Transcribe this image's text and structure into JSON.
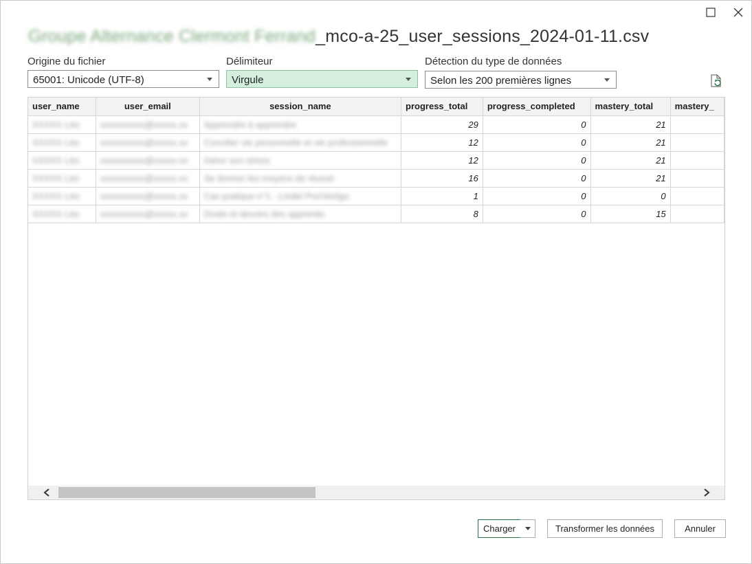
{
  "window": {
    "title_blurred": "Groupe Alternance Clermont Ferrand",
    "title_suffix": "_mco-a-25_user_sessions_2024-01-11.csv"
  },
  "options": {
    "origin": {
      "label": "Origine du fichier",
      "value": "65001: Unicode (UTF-8)"
    },
    "delimiter": {
      "label": "Délimiteur",
      "value": "Virgule"
    },
    "detection": {
      "label": "Détection du type de données",
      "value": "Selon les 200 premières lignes"
    }
  },
  "columns": [
    "user_name",
    "user_email",
    "session_name",
    "progress_total",
    "progress_completed",
    "mastery_total",
    "mastery_"
  ],
  "rows": [
    {
      "user_name": "XXXXX Léo",
      "user_email": "xxxxxxxxxx@xxxxx.xx",
      "session_name": "Apprendre à apprendre",
      "progress_total": "29",
      "progress_completed": "0",
      "mastery_total": "21"
    },
    {
      "user_name": "XXXXX Léo",
      "user_email": "xxxxxxxxxx@xxxxx.xx",
      "session_name": "Concilier vie personnelle et vie professionnelle",
      "progress_total": "12",
      "progress_completed": "0",
      "mastery_total": "21"
    },
    {
      "user_name": "XXXXX Léo",
      "user_email": "xxxxxxxxxx@xxxxx.xx",
      "session_name": "Gérer son stress",
      "progress_total": "12",
      "progress_completed": "0",
      "mastery_total": "21"
    },
    {
      "user_name": "XXXXX Léo",
      "user_email": "xxxxxxxxxx@xxxxx.xx",
      "session_name": "Se donner les moyens de réussir",
      "progress_total": "16",
      "progress_completed": "0",
      "mastery_total": "21"
    },
    {
      "user_name": "XXXXX Léo",
      "user_email": "xxxxxxxxxx@xxxxx.xx",
      "session_name": "Cas pratique n°1 - Lindel Pro/Vertigo",
      "progress_total": "1",
      "progress_completed": "0",
      "mastery_total": "0"
    },
    {
      "user_name": "XXXXX Léo",
      "user_email": "xxxxxxxxxx@xxxxx.xx",
      "session_name": "Droits et devoirs des apprentis",
      "progress_total": "8",
      "progress_completed": "0",
      "mastery_total": "15"
    }
  ],
  "buttons": {
    "load": "Charger",
    "transform": "Transformer les données",
    "cancel": "Annuler"
  },
  "colors": {
    "accent": "#217346",
    "selected_bg": "#d5efdf"
  }
}
